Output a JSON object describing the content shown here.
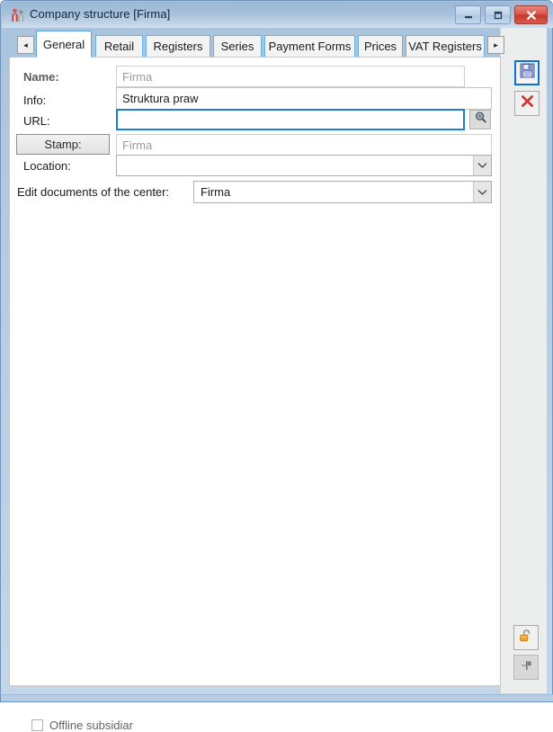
{
  "window": {
    "title": "Company structure [Firma]",
    "icon": "users-icon",
    "controls": {
      "minimize_label": "Minimize",
      "maximize_label": "Maximize",
      "close_label": "Close"
    }
  },
  "tabs": {
    "scroll_left_label": "◂",
    "scroll_right_label": "▸",
    "items": [
      {
        "label": "General",
        "active": true
      },
      {
        "label": "Retail",
        "active": false
      },
      {
        "label": "Registers",
        "active": false
      },
      {
        "label": "Series",
        "active": false
      },
      {
        "label": "Payment Forms",
        "active": false
      },
      {
        "label": "Prices",
        "active": false
      },
      {
        "label": "VAT Registers",
        "active": false
      }
    ]
  },
  "form": {
    "name": {
      "label": "Name:",
      "value": "Firma",
      "is_placeholder": true
    },
    "info": {
      "label": "Info:",
      "value": "Struktura praw",
      "is_placeholder": false
    },
    "url": {
      "label": "URL:",
      "value": "",
      "browse_icon": "magnifier-icon"
    },
    "stamp": {
      "label": "Stamp:",
      "value": "Firma",
      "is_placeholder": true
    },
    "location": {
      "label": "Location:",
      "value": "",
      "arrow": "⌄"
    },
    "edit_documents": {
      "label": "Edit documents of the center:",
      "value": "Firma",
      "arrow": "⌄"
    }
  },
  "offline_subsidiary": {
    "label": "Offline subsidiar",
    "checked": false
  },
  "toolbar": {
    "save": {
      "name": "save-button",
      "icon": "floppy-disk-icon",
      "focused": true
    },
    "cancel": {
      "name": "cancel-button",
      "icon": "red-x-icon"
    },
    "lock": {
      "name": "unlock-button",
      "icon": "open-padlock-icon"
    },
    "flag": {
      "name": "flag-button",
      "icon": "flag-icon",
      "disabled": true
    }
  },
  "colors": {
    "accent": "#1a7fd4",
    "tab_border": "#6cb0e4",
    "title_bar": "#a8c1da",
    "close_button": "#c4372c",
    "lock_orange": "#f0a235"
  }
}
